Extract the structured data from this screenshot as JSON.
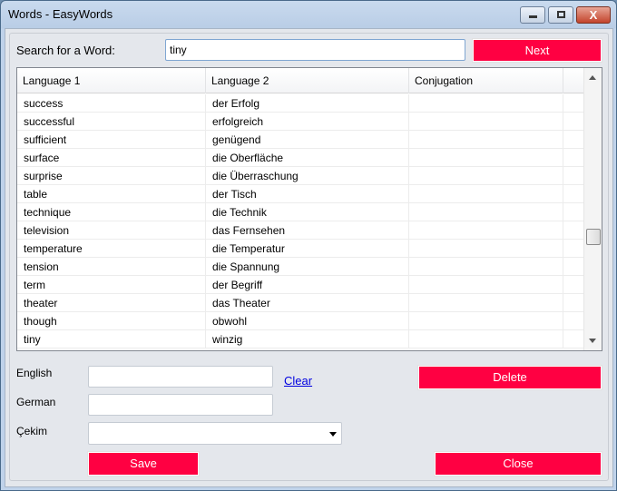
{
  "window": {
    "title": "Words - EasyWords",
    "min": "–",
    "max": "□",
    "close": "X"
  },
  "search": {
    "label": "Search for a Word:",
    "value": "tiny",
    "next": "Next"
  },
  "table": {
    "headers": [
      "Language 1",
      "Language 2",
      "Conjugation"
    ],
    "rows": [
      [
        "success",
        "der Erfolg",
        ""
      ],
      [
        "successful",
        "erfolgreich",
        ""
      ],
      [
        "sufficient",
        "genügend",
        ""
      ],
      [
        "surface",
        "die Oberfläche",
        ""
      ],
      [
        "surprise",
        "die Überraschung",
        ""
      ],
      [
        "table",
        "der Tisch",
        ""
      ],
      [
        "technique",
        "die Technik",
        ""
      ],
      [
        "television",
        "das Fernsehen",
        ""
      ],
      [
        "temperature",
        "die Temperatur",
        ""
      ],
      [
        "tension",
        "die Spannung",
        ""
      ],
      [
        "term",
        "der Begriff",
        ""
      ],
      [
        "theater",
        "das Theater",
        ""
      ],
      [
        "though",
        "obwohl",
        ""
      ],
      [
        "tiny",
        "winzig",
        ""
      ]
    ],
    "scroll_position": 0.62
  },
  "form": {
    "english_label": "English",
    "english_value": "",
    "german_label": "German",
    "german_value": "",
    "cekim_label": "Çekim",
    "cekim_value": "",
    "clear": "Clear",
    "delete": "Delete",
    "save": "Save",
    "close": "Close"
  }
}
